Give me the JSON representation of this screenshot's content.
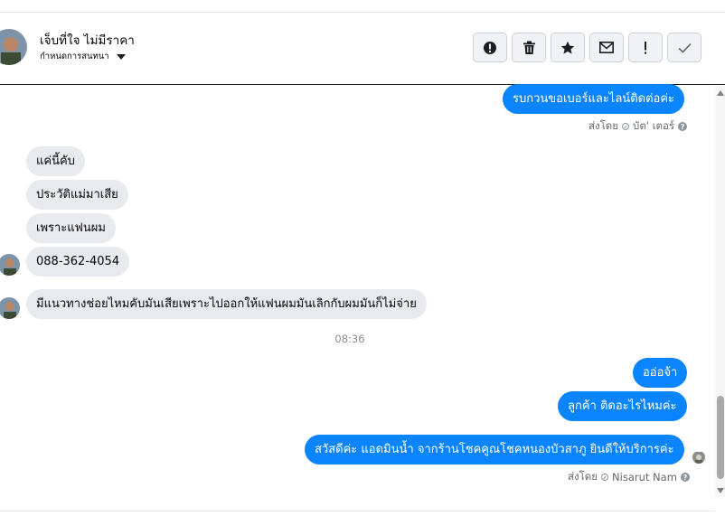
{
  "header": {
    "name": "เจ็บที่ใจ ไม่มีราคา",
    "subtitle": "กำหนดการสนทนา",
    "actions": [
      {
        "name": "report",
        "icon": "alert-circle-icon"
      },
      {
        "name": "delete",
        "icon": "trash-icon"
      },
      {
        "name": "star",
        "icon": "star-icon"
      },
      {
        "name": "mark-unread",
        "icon": "envelope-icon"
      },
      {
        "name": "follow-up",
        "icon": "exclamation-icon"
      },
      {
        "name": "done",
        "icon": "checkmark-icon"
      }
    ]
  },
  "messages": [
    {
      "dir": "out",
      "text": "รบกวนขอเบอร์และไลน์ติดต่อค่ะ"
    },
    {
      "dir": "in",
      "text": "แค่นี้คับ"
    },
    {
      "dir": "in",
      "text": "ประวัติแม่มาเสีย"
    },
    {
      "dir": "in",
      "text": "เพราะแฟนผม"
    },
    {
      "dir": "in",
      "text": "088-362-4054"
    },
    {
      "dir": "in",
      "text": "มีแนวทางช่อยไหมคับมันเสียเพราะไปออกให้แฟนผมมันเลิกกับผมมันก็ไม่จ่าย"
    },
    {
      "dir": "out",
      "text": "ออ่อจ้า"
    },
    {
      "dir": "out",
      "text": "ลูกค้า ติดอะไรไหมค่ะ"
    },
    {
      "dir": "out",
      "text": "สวัสดีค่ะ แอดมินน้ำ จากร้านโชคคูณโชคหนองบัวสาภู ยินดีให้บริการค่ะ"
    }
  ],
  "sent_by": [
    {
      "label": "ส่งโดย",
      "sender": "บัต' เตอร์"
    },
    {
      "label": "ส่งโดย",
      "sender": "Nisarut Nam"
    }
  ],
  "timestamp": "08:36",
  "colors": {
    "outgoing": "#0b84ff",
    "incoming": "#e9eaed"
  }
}
